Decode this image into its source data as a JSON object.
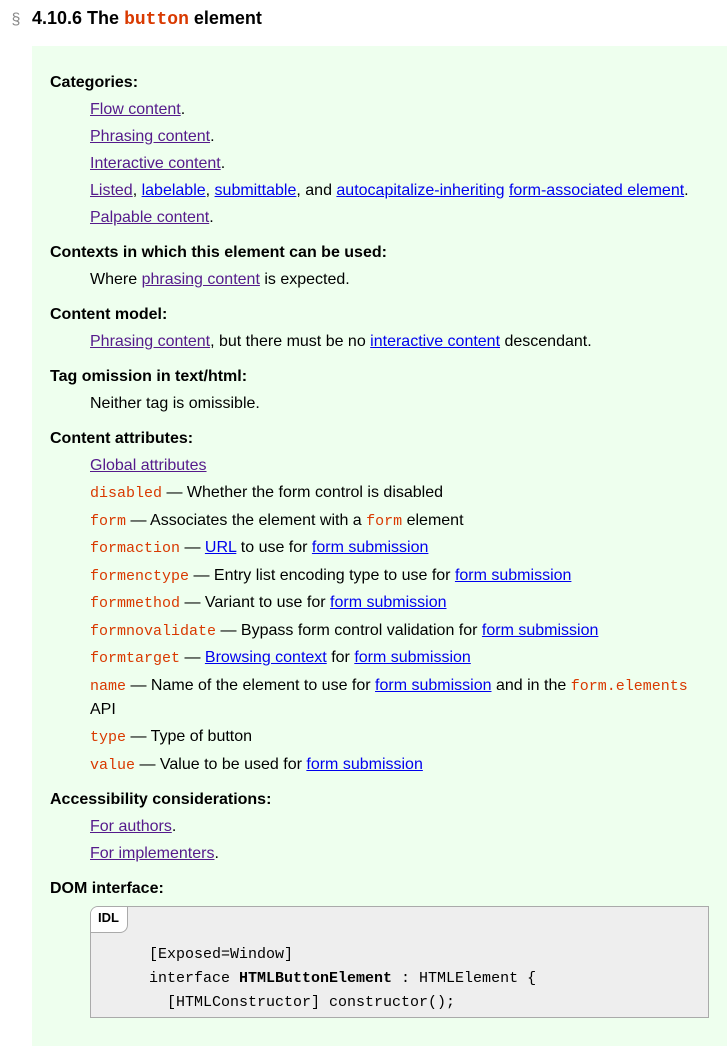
{
  "heading": {
    "marker": "§",
    "prefix": "4.10.6 The ",
    "code": "button",
    "suffix": " element"
  },
  "dl": {
    "categories": {
      "label": "Categories:",
      "l1": "Flow content",
      "l2": "Phrasing content",
      "l3": "Interactive content",
      "l4a": "Listed",
      "l4b": "labelable",
      "l4c": "submittable",
      "l4and": ", and ",
      "l4d": "autocapitalize-inheriting",
      "l4e": "form-associated element",
      "l5": "Palpable content"
    },
    "contexts": {
      "label": "Contexts in which this element can be used:",
      "text1": "Where ",
      "link": "phrasing content",
      "text2": " is expected."
    },
    "contentmodel": {
      "label": "Content model:",
      "link1": "Phrasing content",
      "mid": ", but there must be no ",
      "link2": "interactive content",
      "end": " descendant."
    },
    "tagomission": {
      "label": "Tag omission in text/html:",
      "text": "Neither tag is omissible."
    },
    "attrs": {
      "label": "Content attributes:",
      "global": "Global attributes",
      "disabled": {
        "name": "disabled",
        "desc": " — Whether the form control is disabled"
      },
      "form": {
        "name": "form",
        "desc1": " — Associates the element with a ",
        "code": "form",
        "desc2": " element"
      },
      "formaction": {
        "name": "formaction",
        "dash": " — ",
        "url": "URL",
        "desc2": " to use for ",
        "fs": "form submission"
      },
      "formenctype": {
        "name": "formenctype",
        "desc": " — Entry list encoding type to use for ",
        "fs": "form submission"
      },
      "formmethod": {
        "name": "formmethod",
        "desc": " — Variant to use for ",
        "fs": "form submission"
      },
      "formnovalidate": {
        "name": "formnovalidate",
        "desc": " — Bypass form control validation for ",
        "fs": "form submission"
      },
      "formtarget": {
        "name": "formtarget",
        "dash": " — ",
        "bc": "Browsing context",
        "desc2": " for ",
        "fs": "form submission"
      },
      "name": {
        "name": "name",
        "desc1": " — Name of the element to use for ",
        "fs": "form submission",
        "desc2": " and in the ",
        "api": "form.elements",
        "desc3": " API"
      },
      "type": {
        "name": "type",
        "desc": " — Type of button"
      },
      "value": {
        "name": "value",
        "desc": " — Value to be used for ",
        "fs": "form submission"
      }
    },
    "a11y": {
      "label": "Accessibility considerations:",
      "authors": "For authors",
      "implementers": "For implementers"
    },
    "dom": {
      "label": "DOM interface:",
      "idltag": "IDL",
      "line1": "[Exposed=Window]",
      "line2a": "interface ",
      "line2b": "HTMLButtonElement",
      "line2c": " : HTMLElement {",
      "line3": "  [HTMLConstructor] constructor();"
    }
  }
}
